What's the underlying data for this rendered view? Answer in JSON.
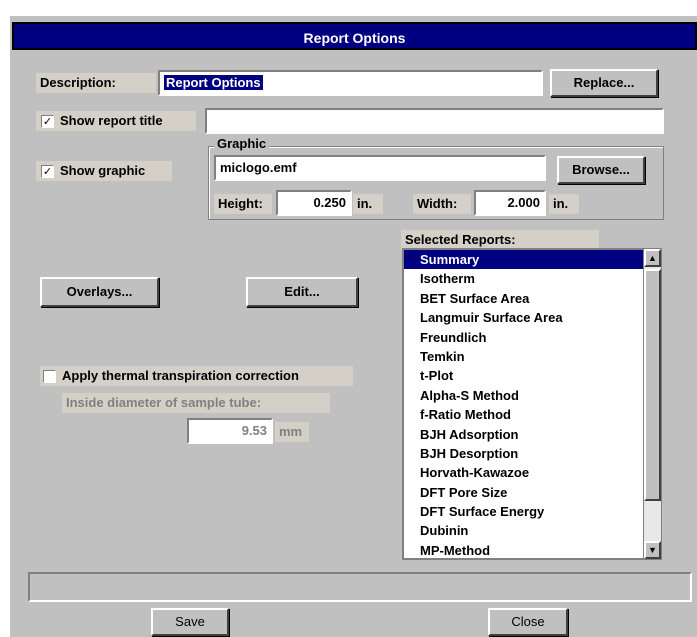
{
  "window": {
    "title": "Report Options"
  },
  "description": {
    "label": "Description:",
    "value": "Report Options",
    "replace_button": "Replace..."
  },
  "show_title": {
    "label": "Show report title",
    "checked": "✓",
    "value": ""
  },
  "show_graphic": {
    "label": "Show graphic",
    "checked": "✓"
  },
  "graphic": {
    "group_label": "Graphic",
    "file": "miclogo.emf",
    "browse_button": "Browse...",
    "height_label": "Height:",
    "height_value": "0.250",
    "height_unit": "in.",
    "width_label": "Width:",
    "width_value": "2.000",
    "width_unit": "in."
  },
  "buttons": {
    "overlays": "Overlays...",
    "edit": "Edit...",
    "save": "Save",
    "close": "Close"
  },
  "thermal": {
    "label": "Apply thermal transpiration correction",
    "inside_label": "Inside diameter of sample tube:",
    "diameter_value": "9.53",
    "diameter_unit": "mm"
  },
  "selected_reports": {
    "label": "Selected Reports:",
    "items": [
      "Summary",
      "Isotherm",
      "BET Surface Area",
      "Langmuir Surface Area",
      "Freundlich",
      "Temkin",
      "t-Plot",
      "Alpha-S Method",
      "f-Ratio Method",
      "BJH Adsorption",
      "BJH Desorption",
      "Horvath-Kawazoe",
      "DFT Pore Size",
      "DFT Surface Energy",
      "Dubinin",
      "MP-Method"
    ]
  },
  "status_bar": {
    "text": ""
  }
}
